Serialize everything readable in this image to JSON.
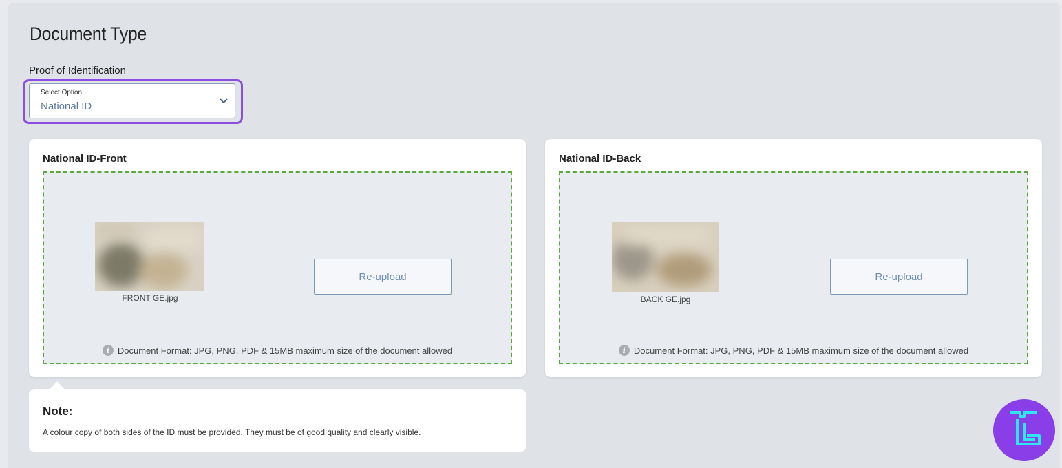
{
  "header": {
    "title": "Document Type"
  },
  "proof_section": {
    "label": "Proof of Identification",
    "select": {
      "caption": "Select Option",
      "value": "National ID"
    }
  },
  "upload_cards": [
    {
      "title": "National ID-Front",
      "file_name": "FRONT GE.jpg",
      "button_label": "Re-upload",
      "format_info": "Document Format: JPG, PNG, PDF & 15MB maximum size of the document allowed"
    },
    {
      "title": "National ID-Back",
      "file_name": "BACK GE.jpg",
      "button_label": "Re-upload",
      "format_info": "Document Format: JPG, PNG, PDF & 15MB maximum size of the document allowed"
    }
  ],
  "note": {
    "title": "Note:",
    "text": "A colour copy of both sides of the ID must be provided. They must be of good quality and clearly visible."
  },
  "icons": {
    "select_chevron": "chevron-down-icon",
    "info": "info-icon",
    "logo": "brand-logo-icon"
  },
  "colors": {
    "focus_ring": "#8c4ee0",
    "dropzone_border": "#5ba83c",
    "button_text": "#6f8fb1",
    "logo_bg": "#8a3ee8",
    "logo_fg": "#2de6f0"
  }
}
